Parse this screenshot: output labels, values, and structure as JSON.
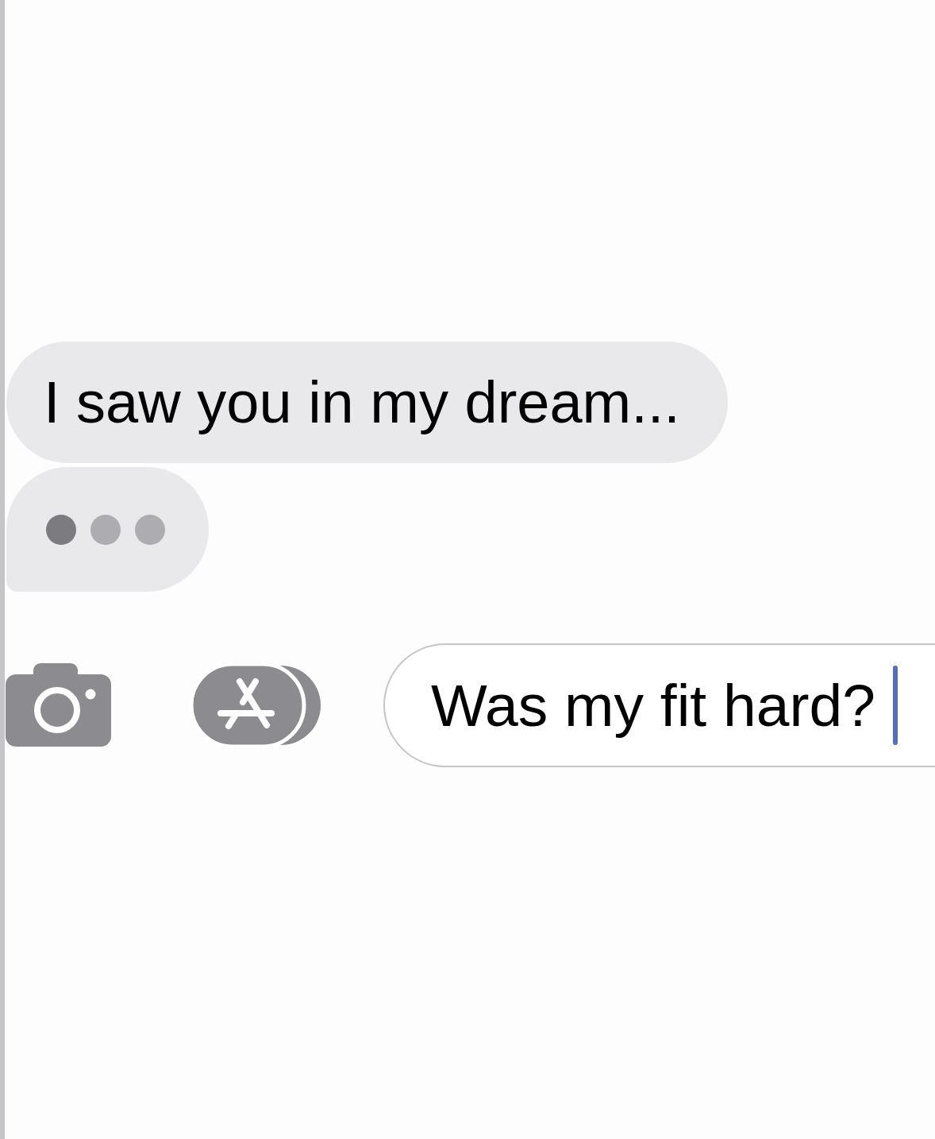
{
  "messages": [
    {
      "text": "I saw you in my dream...",
      "kind": "received"
    }
  ],
  "typing_indicator": {
    "dots": [
      {
        "active": true
      },
      {
        "active": false
      },
      {
        "active": false
      }
    ]
  },
  "composer": {
    "buttons": [
      {
        "kind": "camera"
      },
      {
        "kind": "apps"
      }
    ],
    "message_field": {
      "value": "Was my fit hard?",
      "focused": true
    }
  }
}
